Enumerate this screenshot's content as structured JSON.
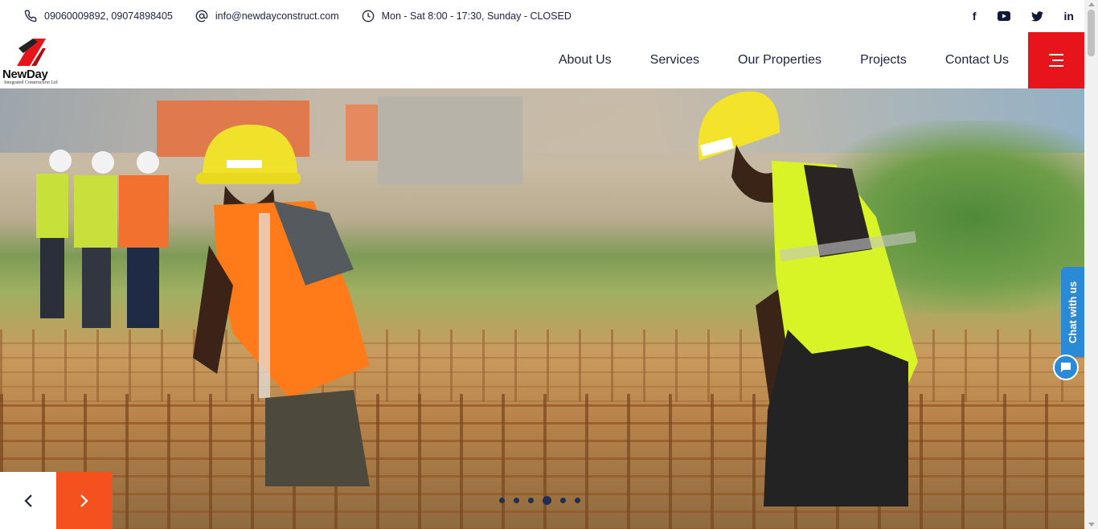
{
  "topbar": {
    "phone": "09060009892, 09074898405",
    "email": "info@newdayconstruct.com",
    "hours": "Mon - Sat 8:00 - 17:30, Sunday - CLOSED",
    "icons": [
      "phone-icon",
      "at-icon",
      "clock-icon"
    ]
  },
  "social": {
    "facebook": "f",
    "youtube": "youtube-icon",
    "twitter": "twitter-icon",
    "linkedin": "in"
  },
  "logo": {
    "brand": "NewDay",
    "tagline": "Integrated Construction Ltd"
  },
  "nav": {
    "items": [
      "About Us",
      "Services",
      "Our Properties",
      "Projects",
      "Contact Us"
    ]
  },
  "colors": {
    "accent_red": "#e8141b",
    "accent_orange": "#f4511e",
    "navy": "#1c2340",
    "chat_blue": "#2a8ad6"
  },
  "hero": {
    "slide_count": 6,
    "active_slide": 4,
    "prev_icon": "chevron-left-icon",
    "next_icon": "chevron-right-icon"
  },
  "chat": {
    "label": "Chat with us",
    "icon": "chat-bubble-icon"
  }
}
